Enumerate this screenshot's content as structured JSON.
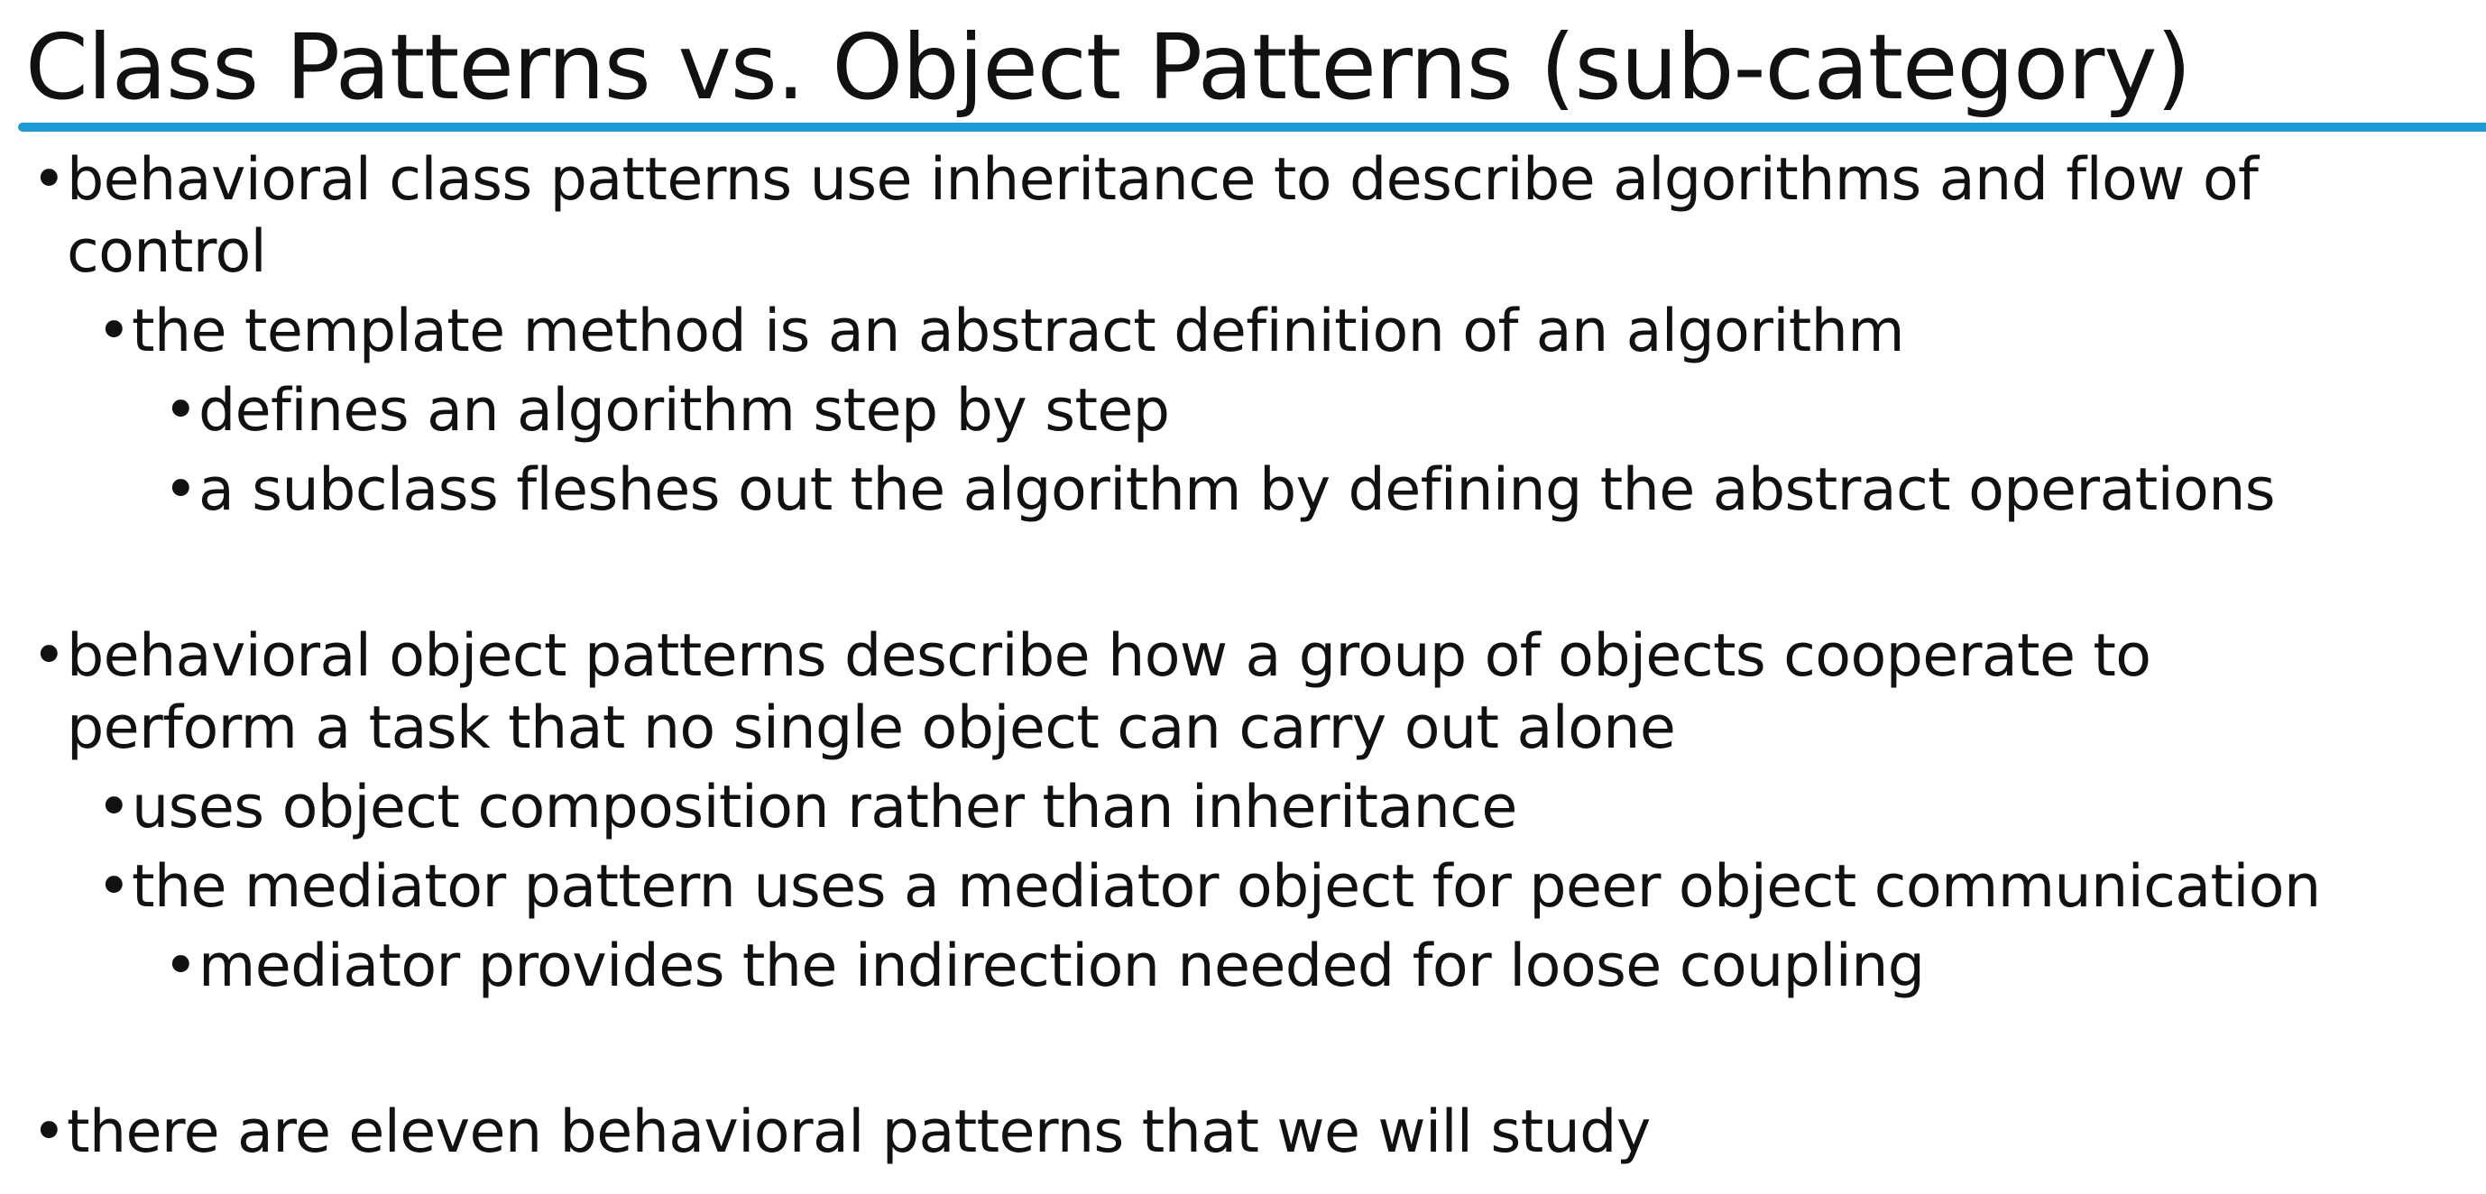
{
  "slide": {
    "title": "Class Patterns vs. Object Patterns (sub-category)"
  },
  "bullets": {
    "b1": {
      "text_line1": "behavioral class patterns use inheritance to describe algorithms and flow of",
      "text_line2": "control",
      "sub1": {
        "text": "the template method is an abstract definition of an algorithm",
        "sub1": "defines an algorithm step by step",
        "sub2": "a subclass fleshes out the algorithm by defining the abstract operations"
      }
    },
    "b2": {
      "text_line1": "behavioral object patterns describe how a group of objects cooperate to",
      "text_line2": "perform a task that no single object can carry out alone",
      "sub1": "uses object composition rather than inheritance",
      "sub2": {
        "text": "the mediator pattern uses a mediator object for peer object communication",
        "sub1": "mediator provides the indirection needed for loose coupling"
      }
    },
    "b3": {
      "text": "there are eleven behavioral patterns that we will study"
    },
    "bullet_glyph": "•"
  },
  "colors": {
    "accent": "#1a9ad6",
    "text": "#111111",
    "background": "#ffffff"
  }
}
